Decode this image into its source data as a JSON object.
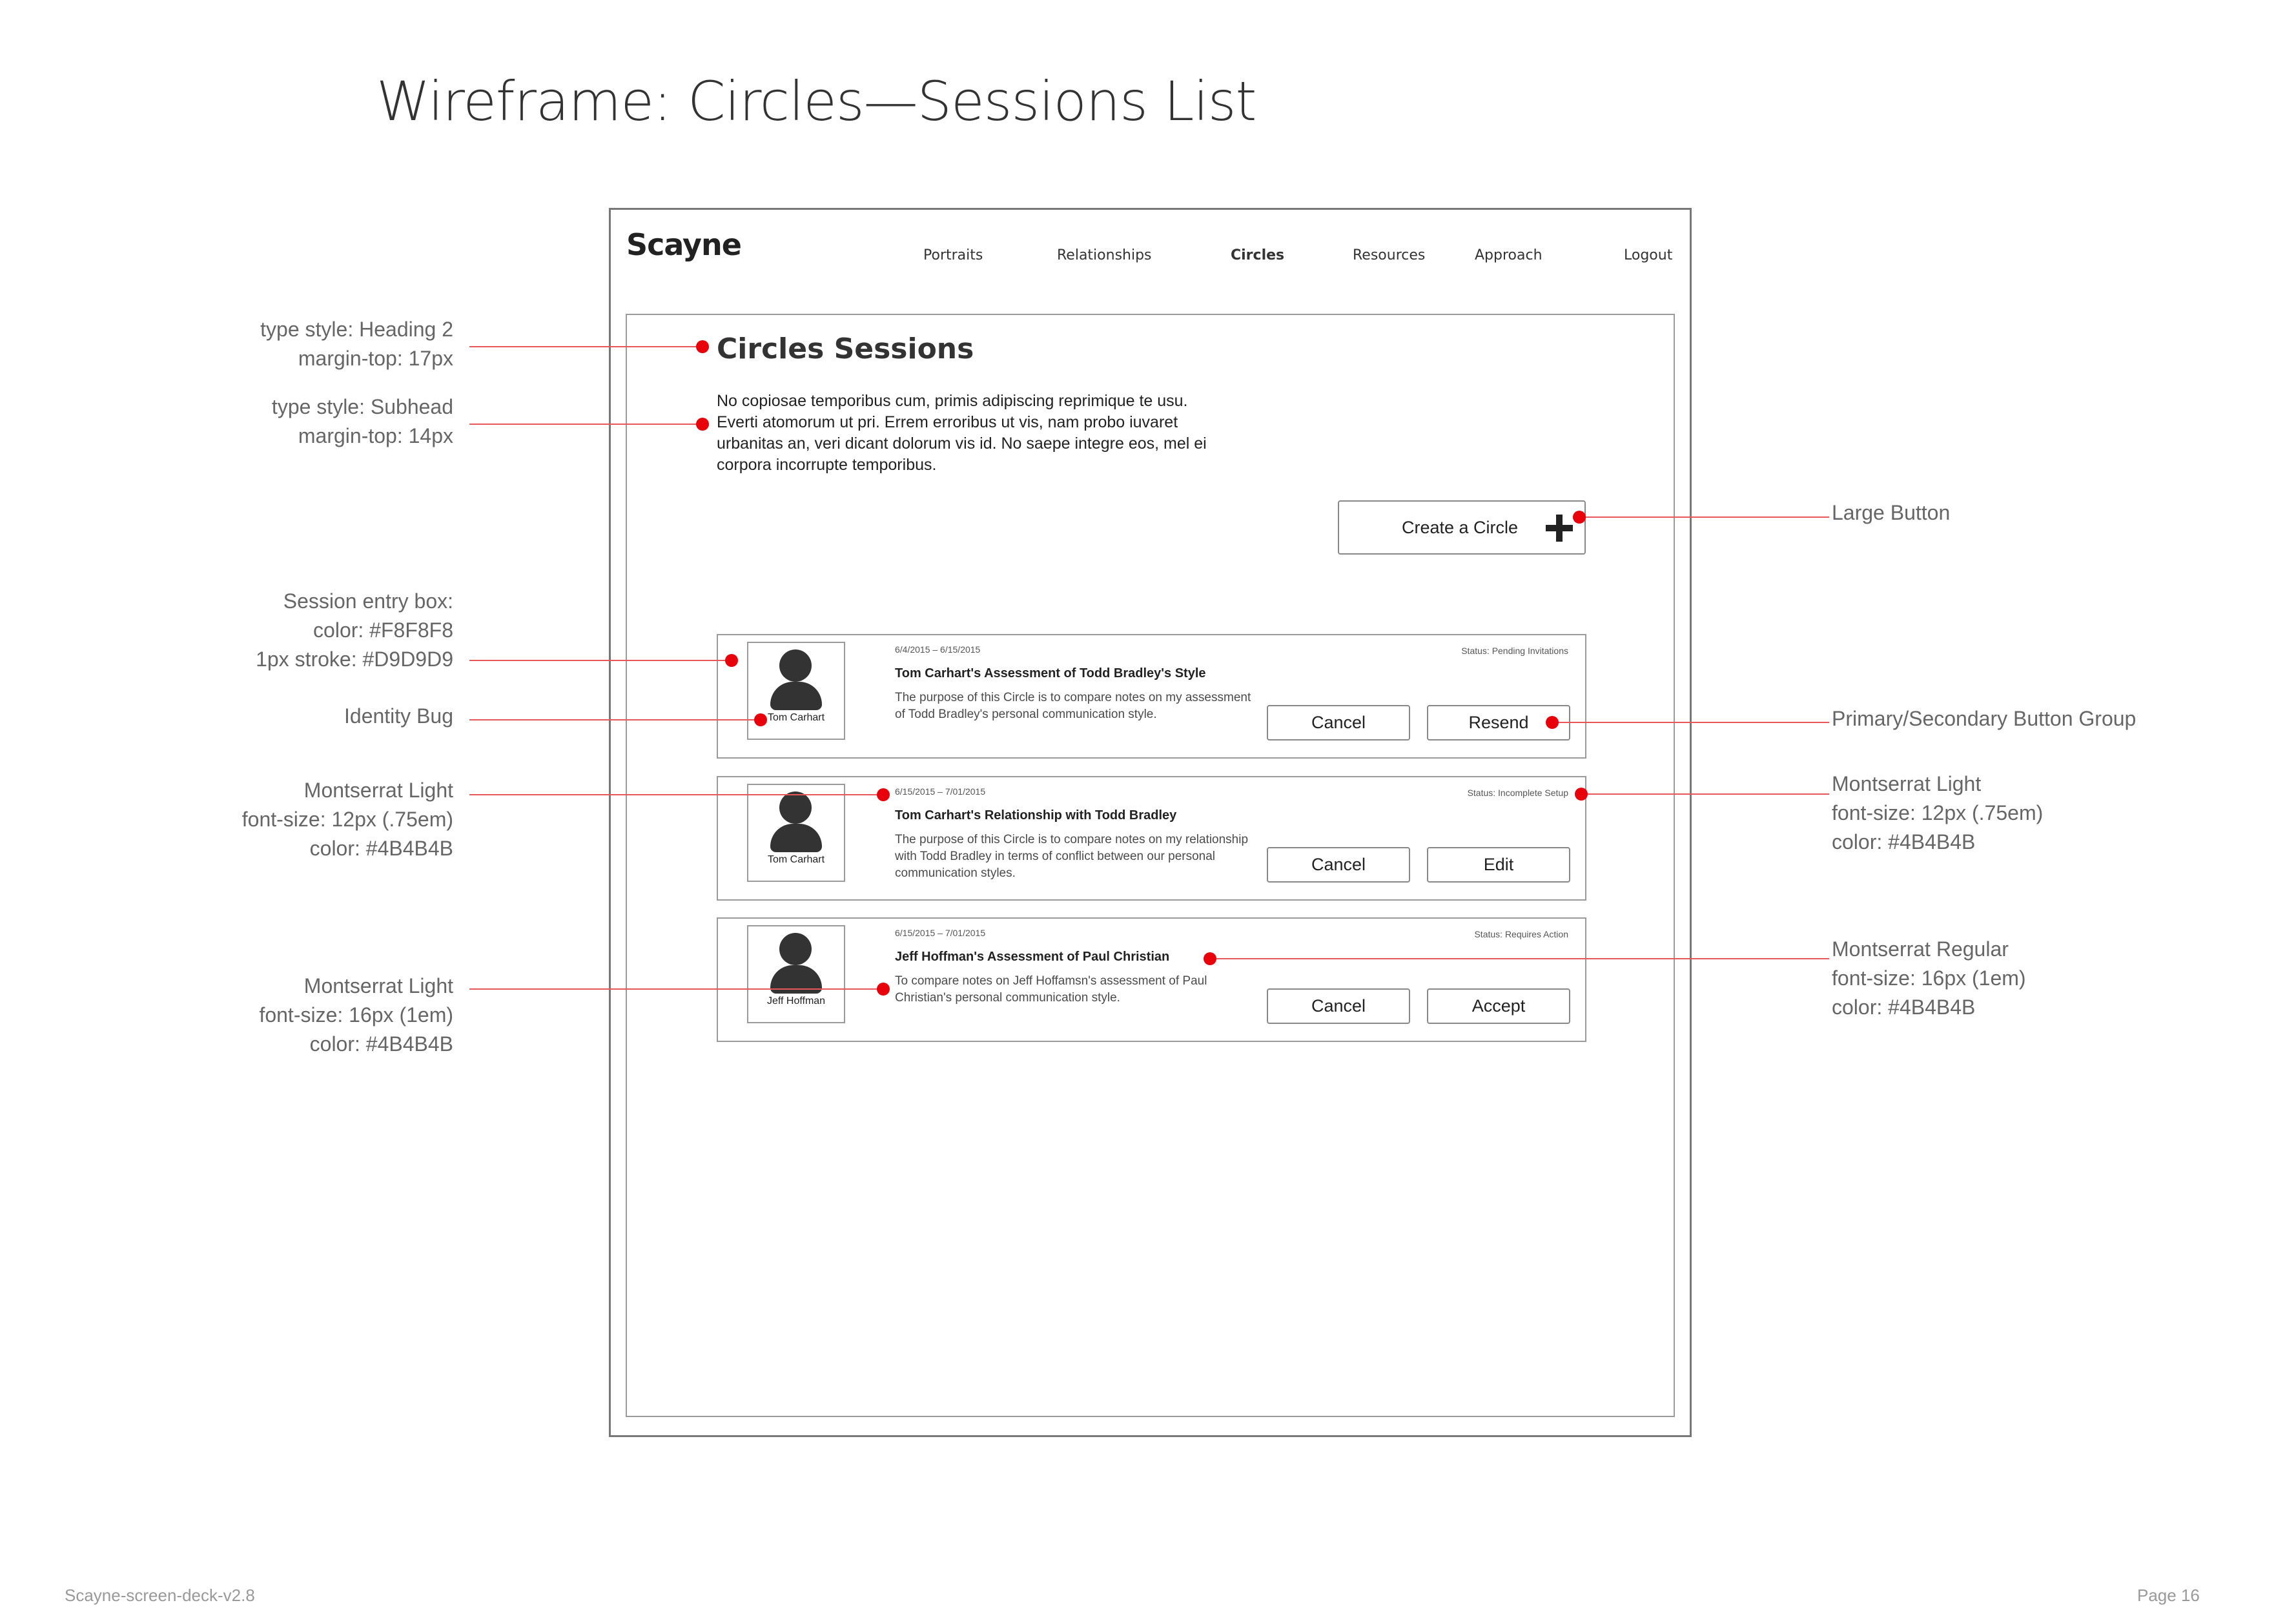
{
  "slide": {
    "title": "Wireframe: Circles—Sessions List",
    "footer_left": "Scayne-screen-deck-v2.8",
    "footer_right": "Page 16"
  },
  "app": {
    "logo": "Scayne",
    "nav": [
      {
        "label": "Portraits",
        "active": false
      },
      {
        "label": "Relationships",
        "active": false
      },
      {
        "label": "Circles",
        "active": true
      },
      {
        "label": "Resources",
        "active": false
      },
      {
        "label": "Approach",
        "active": false
      },
      {
        "label": "Logout",
        "active": false
      }
    ],
    "heading": "Circles Sessions",
    "intro": "No copiosae temporibus cum, primis adipiscing reprimique te usu. Everti atomorum ut pri. Errem erroribus ut vis, nam probo iuvaret urbanitas an, veri dicant dolorum vis id. No saepe integre eos, mel ei corpora incorrupte temporibus.",
    "create_button": "Create a Circle",
    "sessions": [
      {
        "person": "Tom Carhart",
        "dates": "6/4/2015 – 6/15/2015",
        "status": "Status: Pending Invitations",
        "title": "Tom Carhart's Assessment of Todd Bradley's Style",
        "description": "The purpose of this Circle is to compare notes on my assessment of Todd Bradley's personal communication style.",
        "secondary_button": "Cancel",
        "primary_button": "Resend"
      },
      {
        "person": "Tom Carhart",
        "dates": "6/15/2015 – 7/01/2015",
        "status": "Status: Incomplete Setup",
        "title": "Tom Carhart's Relationship with Todd Bradley",
        "description": "The purpose of this Circle is to compare notes on my relationship with Todd Bradley in terms of conflict between our personal communication styles.",
        "secondary_button": "Cancel",
        "primary_button": "Edit"
      },
      {
        "person": "Jeff Hoffman",
        "dates": "6/15/2015 – 7/01/2015",
        "status": "Status: Requires Action",
        "title": "Jeff Hoffman's Assessment of Paul Christian",
        "description": "To compare notes on Jeff Hoffamsn's assessment of Paul Christian's personal communication style.",
        "secondary_button": "Cancel",
        "primary_button": "Accept"
      }
    ]
  },
  "annotations": {
    "heading": "type style: Heading 2\nmargin-top: 17px",
    "subhead": "type style: Subhead\nmargin-top: 14px",
    "session_box": "Session entry box:\ncolor: #F8F8F8\n1px stroke: #D9D9D9",
    "identity_bug": "Identity Bug",
    "light_small_left": "Montserrat Light\nfont-size: 12px (.75em)\ncolor: #4B4B4B",
    "light_large_left": "Montserrat Light\nfont-size: 16px (1em)\ncolor: #4B4B4B",
    "large_button": "Large Button",
    "button_group": "Primary/Secondary Button Group",
    "light_small_right": "Montserrat Light\nfont-size: 12px (.75em)\ncolor: #4B4B4B",
    "regular_right": "Montserrat Regular\nfont-size: 16px (1em)\ncolor: #4B4B4B"
  },
  "colors": {
    "annotation_red": "#e8000b",
    "session_fill": "#F8F8F8",
    "session_stroke": "#D9D9D9",
    "text": "#4B4B4B"
  }
}
